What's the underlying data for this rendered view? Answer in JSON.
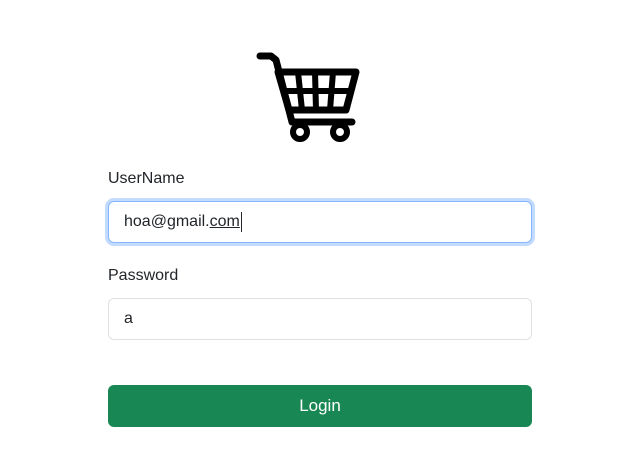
{
  "logo": {
    "icon": "shopping-cart-icon"
  },
  "form": {
    "username_label": "UserName",
    "username_value_prefix": "hoa@gmail.",
    "username_value_suffix": "com",
    "password_label": "Password",
    "password_value": "a",
    "login_label": "Login"
  },
  "colors": {
    "primary_button": "#198754",
    "focus_ring": "#86b7fe",
    "input_border": "#dee2e6",
    "text": "#212529"
  }
}
